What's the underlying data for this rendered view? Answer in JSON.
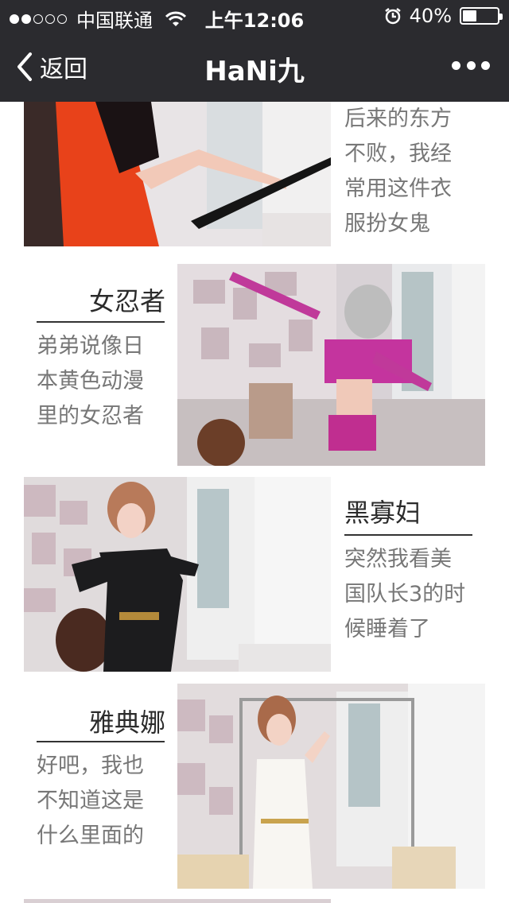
{
  "status_bar": {
    "carrier": "中国联通",
    "time": "上午12:06",
    "battery": "40%",
    "battery_level": 0.4
  },
  "nav": {
    "back_label": "返回",
    "title": "HaNi九"
  },
  "items": [
    {
      "title": "",
      "desc_lines": [
        "后来的东方",
        "不败，我经",
        "常用这件衣",
        "服扮女鬼"
      ]
    },
    {
      "title": "女忍者",
      "desc_lines": [
        "弟弟说像日",
        "本黄色动漫",
        "里的女忍者"
      ]
    },
    {
      "title": "黑寡妇",
      "desc_lines": [
        "突然我看美",
        "国队长3的时",
        "候睡着了"
      ]
    },
    {
      "title": "雅典娜",
      "desc_lines": [
        "好吧，我也",
        "不知道这是",
        "什么里面的"
      ]
    }
  ]
}
